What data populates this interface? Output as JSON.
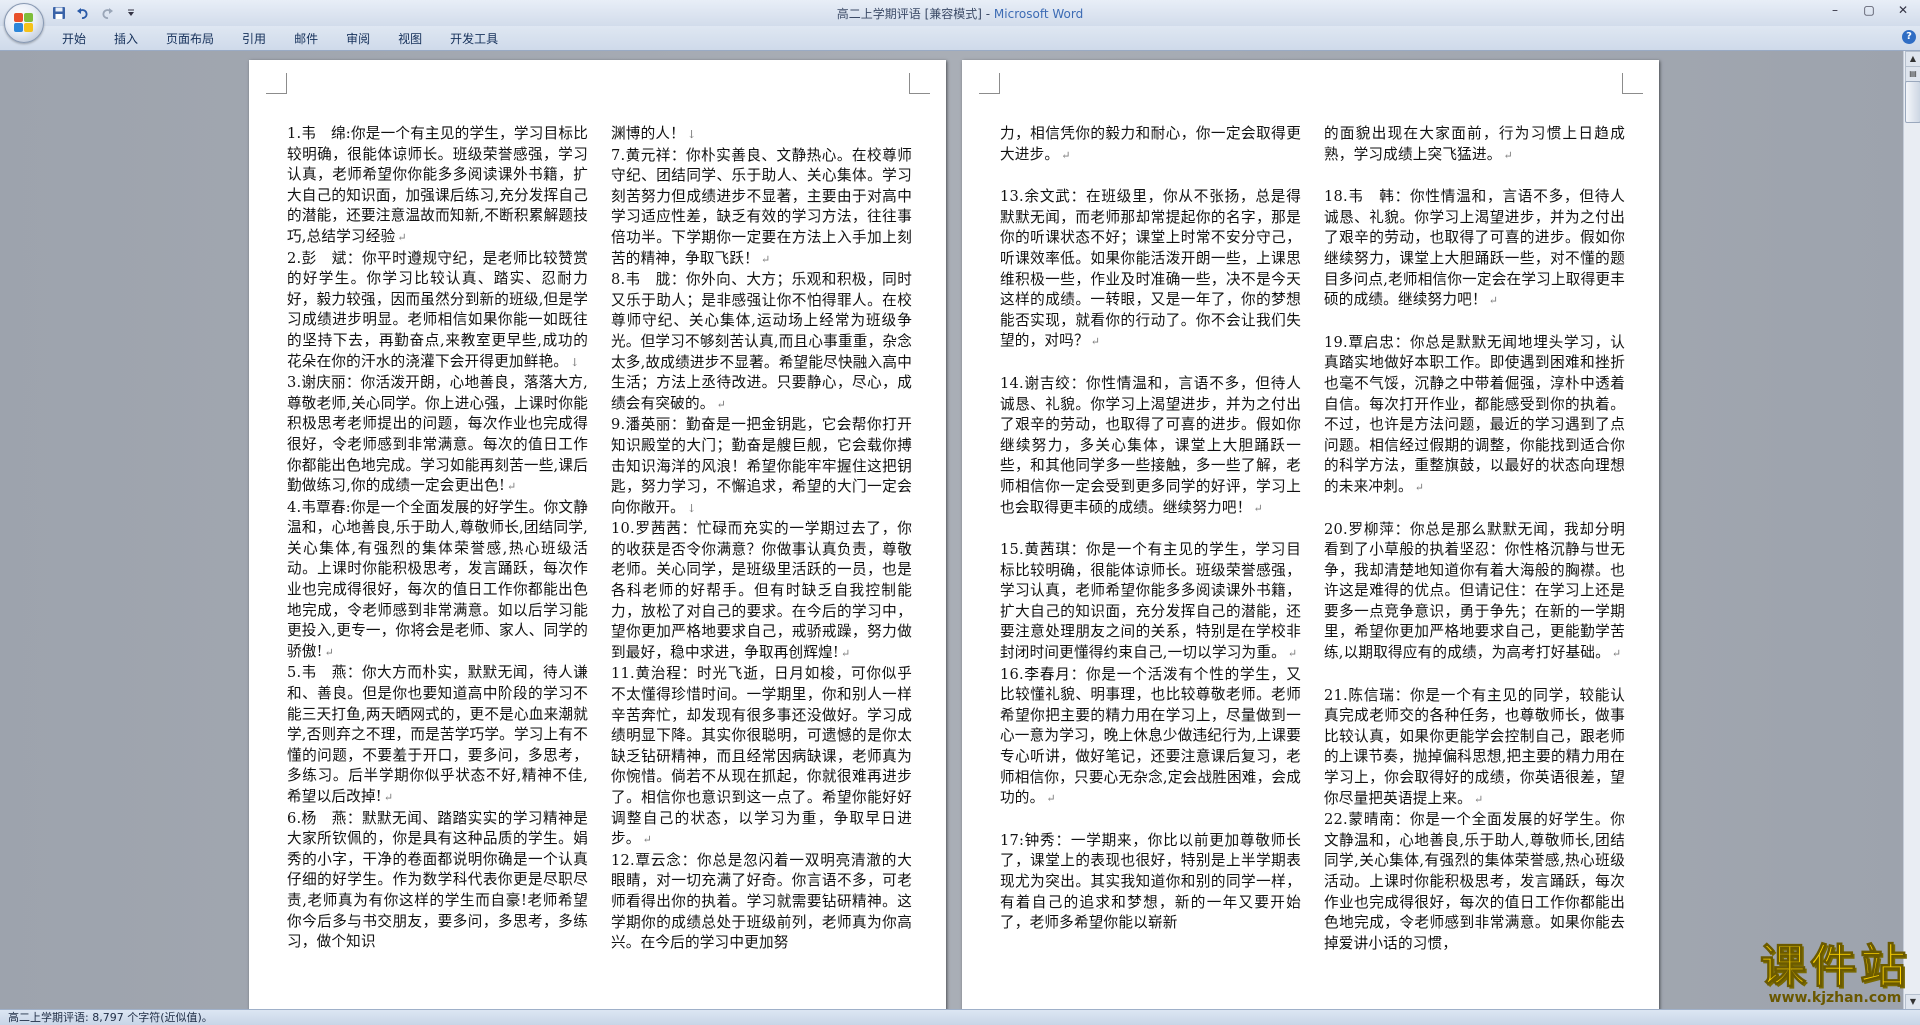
{
  "window": {
    "doc_title": "高二上学期评语 [兼容模式] - ",
    "app_name": "Microsoft Word",
    "controls": [
      "–",
      "▢",
      "✕"
    ]
  },
  "ribbon": {
    "tabs": [
      "开始",
      "插入",
      "页面布局",
      "引用",
      "邮件",
      "审阅",
      "视图",
      "开发工具"
    ]
  },
  "pages": {
    "left": {
      "col1": [
        "1.韦　绵:你是一个有主见的学生，学习目标比较明确，很能体谅师长。班级荣誉感强，学习认真，老师希望你你能多多阅读课外书籍，扩大自己的知识面，加强课后练习,充分发挥自己的潜能，还要注意温故而知新,不断积累解题技巧,总结学习经验",
        "2.彭　斌：你平时遵规守纪，是老师比较赞赏的好学生。你学习比较认真、踏实、忍耐力好，毅力较强，因而虽然分到新的班级,但是学习成绩进步明显。老师相信如果你能一如既往的坚持下去，再勤奋点,来教室更早些,成功的花朵在你的汗水的浇灌下会开得更加鲜艳。",
        "3.谢庆丽：你活泼开朗，心地善良，落落大方,尊敬老师,关心同学。你上进心强，上课时你能积极思考老师提出的问题，每次作业也完成得很好，令老师感到非常满意。每次的值日工作你都能出色地完成。学习如能再刻苦一些,课后勤做练习,你的成绩一定会更出色!",
        "4.韦覃春:你是一个全面发展的好学生。你文静温和，心地善良,乐于助人,尊敬师长,团结同学,关心集体,有强烈的集体荣誉感,热心班级活动。上课时你能积极思考，发言踊跃，每次作业也完成得很好，每次的值日工作你都能出色地完成，令老师感到非常满意。如以后学习能更投入,更专一，你将会是老师、家人、同学的骄傲!",
        "5.韦　燕：你大方而朴实，默默无闻，待人谦和、善良。但是你也要知道高中阶段的学习不能三天打鱼,两天晒网式的，更不是心血来潮就学,否则弃之不理，而是苦学巧学。学习上有不懂的问题，不要羞于开口，要多问，多思考，多练习。后半学期你似乎状态不好,精神不佳,希望以后改掉!",
        "6.杨　燕：默默无闻、踏踏实实的学习精神是大家所钦佩的，你是具有这种品质的学生。娟秀的小字，干净的卷面都说明你确是一个认真仔细的好学生。作为数学科代表你更是尽职尽责,老师真为有你这样的学生而自豪!老师希望你今后多与书交朋友，要多问，多思考，多练习，做个知识"
      ],
      "col2": [
        "渊博的人！",
        "7.黄元祥：你朴实善良、文静热心。在校尊师守纪、团结同学、乐于助人、关心集体。学习刻苦努力但成绩进步不显著，主要由于对高中学习适应性差，缺乏有效的学习方法，往往事倍功半。下学期你一定要在方法上入手加上刻苦的精神，争取飞跃！",
        "8.韦　胧：你外向、大方；乐观和积极，同时又乐于助人；是非感强让你不怕得罪人。在校尊师守纪、关心集体,运动场上经常为班级争光。但学习不够刻苦认真,而且心事重重，杂念太多,故成绩进步不显著。希望能尽快融入高中生活；方法上丞待改进。只要静心，尽心，成绩会有突破的。",
        "9.潘英丽：勤奋是一把金钥匙，它会帮你打开知识殿堂的大门；勤奋是艘巨舰，它会载你搏击知识海洋的风浪！希望你能牢牢握住这把钥匙，努力学习，不懈追求，希望的大门一定会向你敞开。",
        "10.罗茜茜：忙碌而充实的一学期过去了，你的收获是否令你满意？你做事认真负责，尊敬老师。关心同学，是班级里活跃的一员，也是各科老师的好帮手。但有时缺乏自我控制能力，放松了对自己的要求。在今后的学习中，望你更加严格地要求自己，戒骄戒躁，努力做到最好，稳中求进，争取再创辉煌!",
        "11.黄治程：时光飞逝，日月如梭，可你似乎不太懂得珍惜时间。一学期里，你和别人一样辛苦奔忙，却发现有很多事还没做好。学习成绩明显下降。其实你很聪明，可遗憾的是你太缺乏钻研精神，而且经常因病缺课，老师真为你惋惜。倘若不从现在抓起，你就很难再进步了。相信你也意识到这一点了。希望你能好好调整自己的状态，以学习为重，争取早日进步。",
        "12.覃云念：你总是忽闪着一双明亮清澈的大眼睛，对一切充满了好奇。你言语不多，可老师看得出你的执着。学习就需要钻研精神。这学期你的成绩总处于班级前列，老师真为你高兴。在今后的学习中更加努"
      ]
    },
    "right": {
      "col1": [
        "力，相信凭你的毅力和耐心，你一定会取得更大进步。",
        "13.余文武：在班级里，你从不张扬，总是得默默无闻，而老师那却常提起你的名字，那是你的听课状态不好；课堂上时常不安分守己，听课效率低。如果你能活泼开朗一些，上课思维积极一些，作业及时准确一些，决不是今天这样的成绩。一转眼，又是一年了，你的梦想能否实现，就看你的行动了。你不会让我们失望的，对吗？",
        "14.谢吉绞：你性情温和，言语不多，但待人诚恳、礼貌。你学习上渴望进步，并为之付出了艰辛的劳动，也取得了可喜的进步。假如你继续努力，多关心集体，课堂上大胆踊跃一些，和其他同学多一些接触，多一些了解，老师相信你一定会受到更多同学的好评，学习上也会取得更丰硕的成绩。继续努力吧！",
        "15.黄茜琪：你是一个有主见的学生，学习目标比较明确，很能体谅师长。班级荣誉感强，学习认真，老师希望你能多多阅读课外书籍，扩大自己的知识面，充分发挥自己的潜能，还要注意处理朋友之间的关系，特别是在学校非封闭时间更懂得约束自己,一切以学习为重。",
        "16.李春月：你是一个活泼有个性的学生，又比较懂礼貌、明事理，也比较尊敬老师。老师希望你把主要的精力用在学习上，尽量做到一心一意为学习，晚上休息少做违纪行为,上课要专心听讲，做好笔记，还要注意课后复习，老师相信你，只要心无杂念,定会战胜困难，会成功的。",
        "17:钟秀：一学期来，你比以前更加尊敬师长了，课堂上的表现也很好，特别是上半学期表现尤为突出。其实我知道你和别的同学一样，有着自己的追求和梦想，新的一年又要开始了，老师多希望你能以崭新"
      ],
      "col2": [
        "的面貌出现在大家面前，行为习惯上日趋成熟，学习成绩上突飞猛进。",
        "18.韦　韩：你性情温和，言语不多，但待人诚恳、礼貌。你学习上渴望进步，并为之付出了艰辛的劳动，也取得了可喜的进步。假如你继续努力，课堂上大胆踊跃一些，对不懂的题目多问点,老师相信你一定会在学习上取得更丰硕的成绩。继续努力吧！",
        "19.覃启忠：你总是默默无闻地埋头学习，认真踏实地做好本职工作。即使遇到困难和挫折也毫不气馁，沉静之中带着倔强，淳朴中透着自信。每次打开作业，都能感受到你的执着。不过，也许是方法问题，最近的学习遇到了点问题。相信经过假期的调整，你能找到适合你的科学方法，重整旗鼓，以最好的状态向理想的未来冲刺。",
        "20.罗柳萍：你总是那么默默无闻，我却分明看到了小草般的执着坚忍：你性格沉静与世无争，我却清楚地知道你有着大海般的胸襟。也许这是难得的优点。但请记住：在学习上还是要多一点竞争意识，勇于争先；在新的一学期里，希望你更加严格地要求自己，更能勤学苦练,以期取得应有的成绩，为高考打好基础。",
        "21.陈信瑞：你是一个有主见的同学，较能认真完成老师交的各种任务，也尊敬师长，做事比较认真，如果你更能学会控制自己，跟老师的上课节奏，抛掉偏科思想,把主要的精力用在学习上，你会取得好的成绩，你英语很差，望你尽量把英语提上来。",
        "22.蒙晴南：你是一个全面发展的好学生。你文静温和，心地善良,乐于助人,尊敬师长,团结同学,关心集体,有强烈的集体荣誉感,热心班级活动。上课时你能积极思考，发言踊跃，每次作业也完成得很好，每次的值日工作你都能出色地完成，令老师感到非常满意。如果你能去掉爱讲小话的习惯，"
      ]
    }
  },
  "statusbar": {
    "text": "高二上学期评语: 8,797 个字符(近似值)。"
  },
  "watermark": {
    "main": "课件站",
    "sub": "www.kjzhan.com"
  }
}
